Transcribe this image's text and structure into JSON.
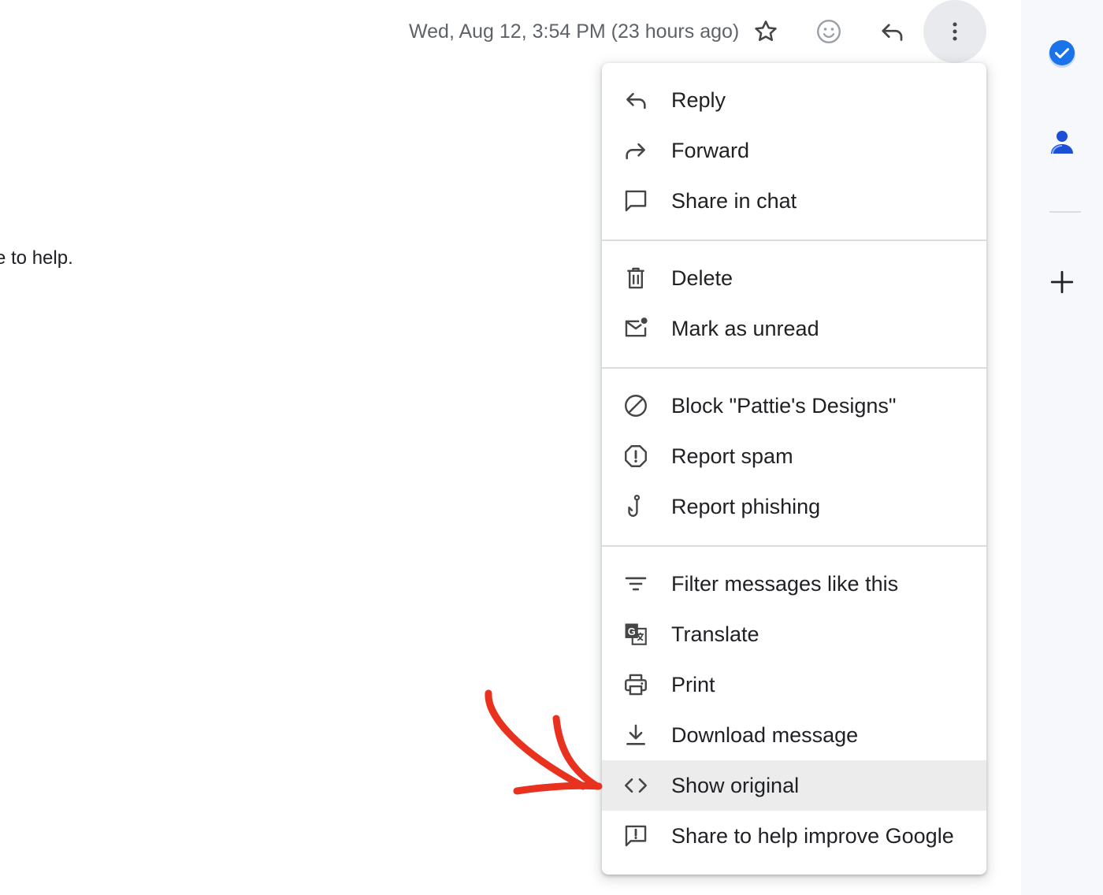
{
  "header": {
    "date": "Wed, Aug 12, 3:54 PM (23 hours ago)",
    "icons": [
      "star-icon",
      "emoji-icon",
      "reply-icon",
      "more-vert-icon"
    ]
  },
  "message": {
    "body_fragment": "e to help."
  },
  "menu": {
    "items": [
      {
        "label": "Reply",
        "icon": "reply-icon"
      },
      {
        "label": "Forward",
        "icon": "forward-icon"
      },
      {
        "label": "Share in chat",
        "icon": "chat-icon"
      },
      {
        "label": "Delete",
        "icon": "trash-icon"
      },
      {
        "label": "Mark as unread",
        "icon": "mark-unread-icon"
      },
      {
        "label": "Block \"Pattie's Designs\"",
        "icon": "block-icon"
      },
      {
        "label": "Report spam",
        "icon": "spam-icon"
      },
      {
        "label": "Report phishing",
        "icon": "phishing-hook-icon"
      },
      {
        "label": "Filter messages like this",
        "icon": "filter-icon"
      },
      {
        "label": "Translate",
        "icon": "translate-icon"
      },
      {
        "label": "Print",
        "icon": "print-icon"
      },
      {
        "label": "Download message",
        "icon": "download-icon"
      },
      {
        "label": "Show original",
        "icon": "code-icon",
        "highlighted": true
      },
      {
        "label": "Share to help improve Google",
        "icon": "feedback-icon"
      }
    ]
  },
  "side_panel": {
    "icons": [
      "tasks-icon",
      "contacts-icon",
      "add-icon"
    ]
  },
  "colors": {
    "accent_blue": "#1a73e8",
    "annotation_red": "#e8311f",
    "highlight_row": "#ececec",
    "side_panel_bg": "#f6f8fc"
  }
}
